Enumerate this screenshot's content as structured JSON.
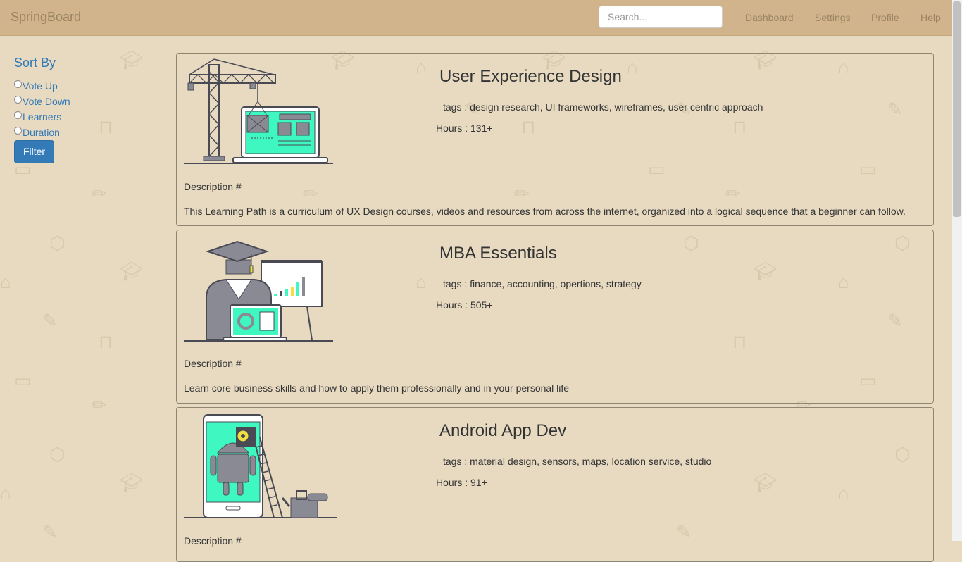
{
  "header": {
    "brand": "SpringBoard",
    "search_placeholder": "Search...",
    "nav": [
      "Dashboard",
      "Settings",
      "Profile",
      "Help"
    ]
  },
  "sidebar": {
    "title": "Sort By",
    "options": [
      "Vote Up",
      "Vote Down",
      "Learners",
      "Duration"
    ],
    "filter_label": "Filter"
  },
  "courses": [
    {
      "title": "User Experience Design",
      "tags": "tags : design research, UI frameworks, wireframes, user centric approach",
      "hours": "Hours : 131+",
      "description_label": "Description #",
      "description": "This Learning Path is a curriculum of UX Design courses, videos and resources from across the internet, organized into a logical sequence that a beginner can follow.",
      "illustration": "crane-laptop-illustration"
    },
    {
      "title": "MBA Essentials",
      "tags": "tags : finance, accounting, opertions, strategy",
      "hours": "Hours : 505+",
      "description_label": "Description #",
      "description": "Learn core business skills and how to apply them professionally and in your personal life",
      "illustration": "graduate-presentation-illustration"
    },
    {
      "title": "Android App Dev",
      "tags": "tags : material design, sensors, maps, location service, studio",
      "hours": "Hours : 91+",
      "description_label": "Description #",
      "description": "",
      "illustration": "android-phone-illustration"
    }
  ],
  "colors": {
    "navbar": "#d2b48c",
    "page_background": "#e7dac1",
    "link": "#337ab7",
    "illustration_accent": "#3ff7c0"
  }
}
